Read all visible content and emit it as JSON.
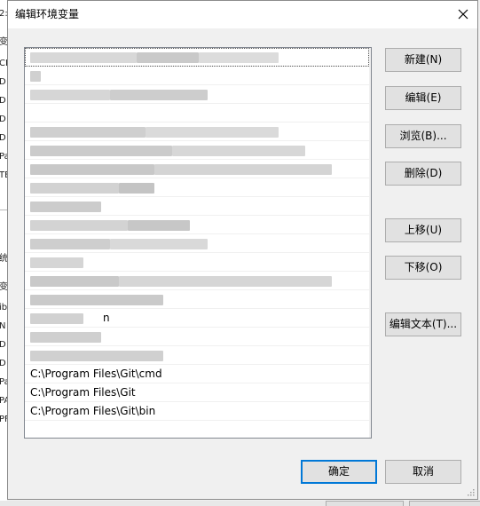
{
  "dialog": {
    "title": "编辑环境变量",
    "close_label": "×"
  },
  "path_list": {
    "visible_entries": [
      "C:\\Program Files\\Git\\cmd",
      "C:\\Program Files\\Git",
      "C:\\Program Files\\Git\\bin"
    ],
    "partial_text": "n"
  },
  "buttons": {
    "new_label": "新建(N)",
    "edit_label": "编辑(E)",
    "browse_label": "浏览(B)...",
    "delete_label": "删除(D)",
    "move_up_label": "上移(U)",
    "move_down_label": "下移(O)",
    "edit_text_label": "编辑文本(T)...",
    "ok_label": "确定",
    "cancel_label": "取消"
  },
  "background_window": {
    "left_fragments": [
      "2:",
      "变",
      "CL",
      "D",
      "D",
      "D",
      "D",
      "Pa",
      "TE",
      "统",
      "变",
      "ib",
      "N",
      "D",
      "D",
      "Pa",
      "PA",
      "PF"
    ]
  },
  "colors": {
    "dialog_bg": "#f0f0f0",
    "titlebar_bg": "#ffffff",
    "button_bg": "#e1e1e1",
    "button_border": "#adadad",
    "accent_blue": "#0078d7"
  }
}
